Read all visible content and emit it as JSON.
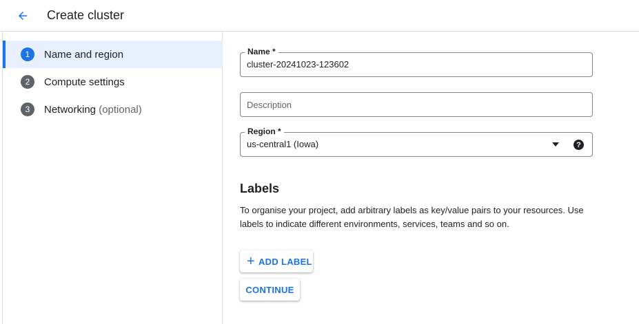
{
  "header": {
    "back_icon": "arrow-back-icon",
    "title": "Create cluster"
  },
  "stepper": {
    "steps": [
      {
        "number": "1",
        "label": "Name and region",
        "optional": "",
        "active": true
      },
      {
        "number": "2",
        "label": "Compute settings",
        "optional": "",
        "active": false
      },
      {
        "number": "3",
        "label": "Networking",
        "optional": "(optional)",
        "active": false
      }
    ]
  },
  "form": {
    "name": {
      "label": "Name *",
      "value": "cluster-20241023-123602"
    },
    "description": {
      "placeholder": "Description",
      "value": ""
    },
    "region": {
      "label": "Region *",
      "value": "us-central1 (Iowa)",
      "help_icon": "help-icon"
    }
  },
  "labels": {
    "heading": "Labels",
    "description": "To organise your project, add arbitrary labels as key/value pairs to your resources. Use labels to indicate different environments, services, teams and so on.",
    "add_icon": "plus-icon",
    "add_button": "ADD LABEL"
  },
  "actions": {
    "continue_button": "CONTINUE"
  },
  "colors": {
    "accent": "#1a73e8",
    "active_step_bg": "#e8f0fe",
    "inactive_step": "#5f6368",
    "border": "#dadce0"
  }
}
